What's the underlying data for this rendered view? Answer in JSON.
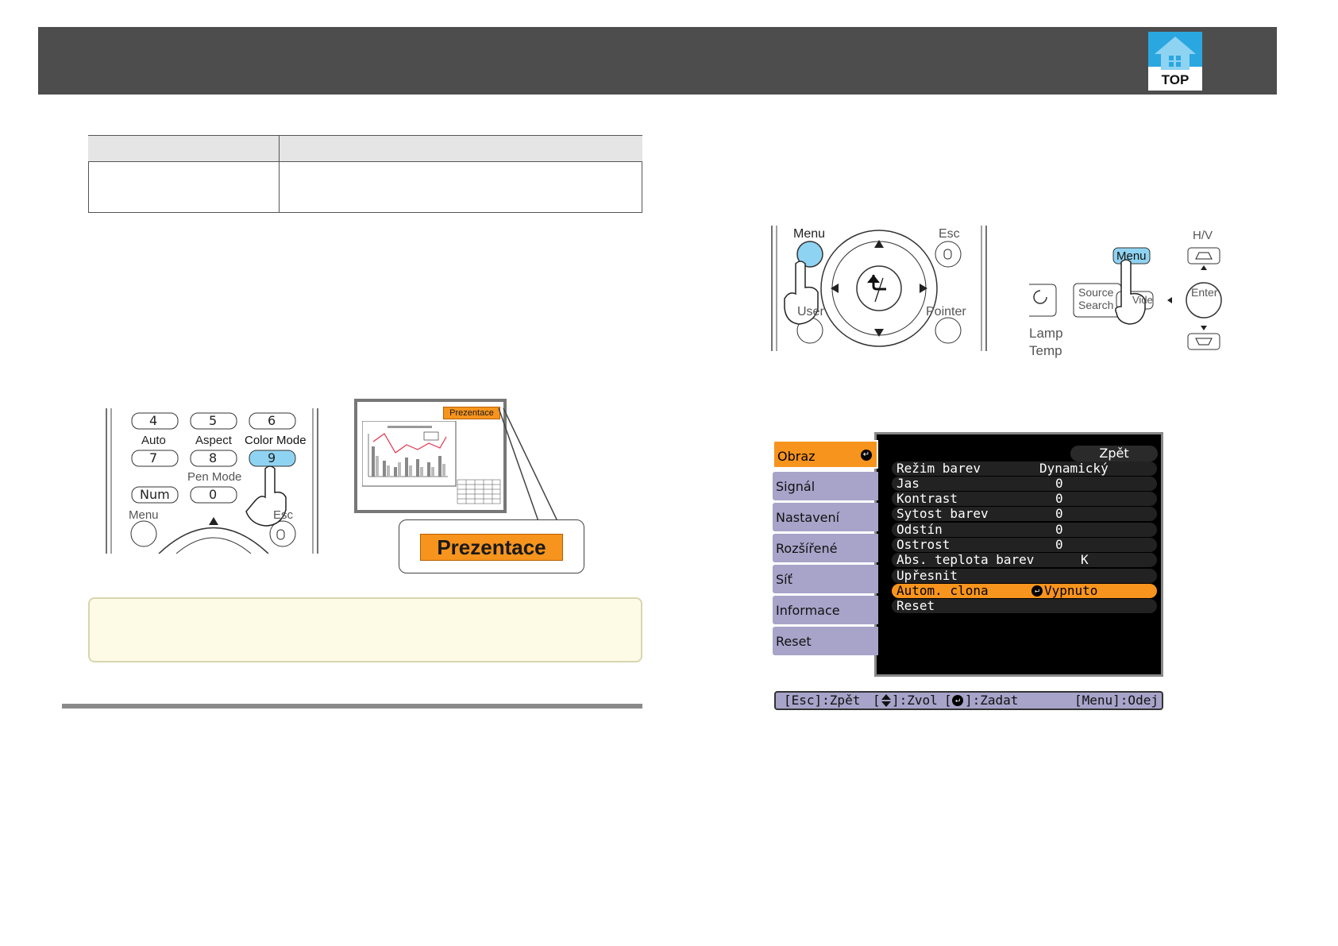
{
  "header": {
    "top_button_label": "TOP"
  },
  "remote_a": {
    "buttons": [
      "4",
      "5",
      "6",
      "7",
      "8",
      "9",
      "0"
    ],
    "labels": {
      "auto": "Auto",
      "aspect": "Aspect",
      "color_mode": "Color Mode",
      "pen_mode": "Pen Mode",
      "num": "Num",
      "menu": "Menu",
      "esc": "Esc"
    }
  },
  "screen_illustration": {
    "badge_small": "Prezentace",
    "badge_large": "Prezentace"
  },
  "remote_b": {
    "labels": {
      "menu": "Menu",
      "esc": "Esc",
      "user": "User",
      "pointer": "Pointer"
    }
  },
  "control_panel": {
    "labels": {
      "menu": "Menu",
      "hv": "H/V",
      "source_search_1": "Source",
      "source_search_2": "Search",
      "wide": "Vide",
      "enter": "Enter",
      "lamp": "Lamp",
      "temp": "Temp"
    }
  },
  "osd_menu": {
    "sidebar": [
      "Obraz",
      "Signál",
      "Nastavení",
      "Rozšířené",
      "Síť",
      "Informace",
      "Reset"
    ],
    "active_index": 0,
    "back_label": "Zpět",
    "rows": [
      {
        "label": "Režim barev",
        "value": "Dynamický"
      },
      {
        "label": "Jas",
        "value": "0"
      },
      {
        "label": "Kontrast",
        "value": "0"
      },
      {
        "label": "Sytost barev",
        "value": "0"
      },
      {
        "label": "Odstín",
        "value": "0"
      },
      {
        "label": "Ostrost",
        "value": "0"
      },
      {
        "label": "Abs. teplota barev",
        "value": "K"
      },
      {
        "label": "Upřesnit",
        "value": ""
      },
      {
        "label": "Autom. clona",
        "value": "Vypnuto"
      },
      {
        "label": "Reset",
        "value": ""
      }
    ],
    "selected_row": 8,
    "footer": {
      "esc": "[Esc]:Zpět",
      "select": "]:Zvol",
      "enter": "]:Zadat",
      "menu": "[Menu]:Odej"
    }
  },
  "colors": {
    "accent": "#f7941d",
    "menu_side": "#a7a3c9",
    "header": "#4d4d4d",
    "note_bg": "#fdfbe6"
  }
}
